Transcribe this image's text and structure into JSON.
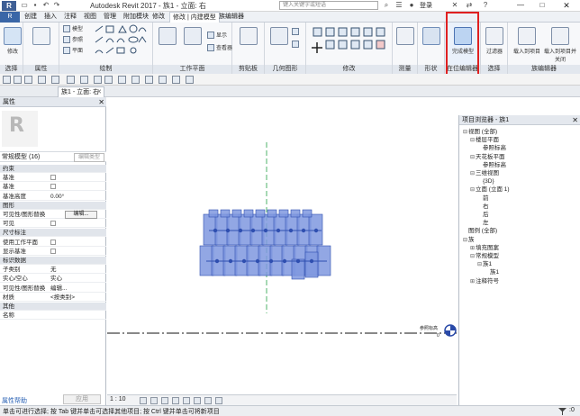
{
  "titlebar": {
    "app_logo": "R",
    "title": "Autodesk Revit 2017 -   族1 - 立面: 右",
    "search_placeholder": "键入关键字或短语",
    "user": "登录",
    "min": "—",
    "max": "□",
    "close": "✕"
  },
  "ribbon_tabs": {
    "file": "R",
    "tabs": [
      "创建",
      "插入",
      "注释",
      "视图",
      "管理",
      "附加模块",
      "修改",
      "修改 | 内建模型",
      "族编辑器"
    ]
  },
  "ribbon": {
    "modify_label": "修改",
    "panels": [
      "选择",
      "属性",
      "绘制",
      "工作平面",
      "剪贴板",
      "几何图形",
      "修改",
      "测量",
      "形状",
      "在位编辑器",
      "选择",
      "族编辑器"
    ],
    "draw_rows": [
      "模型",
      "参照",
      "平面"
    ],
    "tool_rows_a": [
      "显示",
      "查看器"
    ],
    "finish_model_label": "完成模型",
    "filter_label": "过滤器",
    "load_into_project_label": "载入到项目",
    "load_into_project_close_label": "载入到项目并关闭"
  },
  "view_tab": {
    "label": "族1 - 立面: 右",
    "close": "✕"
  },
  "properties": {
    "title": "属性",
    "close": "✕",
    "thumb_letter": "R",
    "type_selector": "常规模型 (16)",
    "edit_type_label": "编辑类型",
    "rows": [
      {
        "kind": "cat",
        "k": "约束"
      },
      {
        "kind": "cb",
        "k": "基准"
      },
      {
        "kind": "cb",
        "k": "基准"
      },
      {
        "kind": "val",
        "k": "基准高度",
        "v": "0.00°"
      },
      {
        "kind": "cat",
        "k": "图形"
      },
      {
        "kind": "box",
        "k": "可见性/图形替换",
        "v": "编辑..."
      },
      {
        "kind": "cb",
        "k": "可见"
      },
      {
        "kind": "cat",
        "k": "尺寸标注"
      },
      {
        "kind": "cb",
        "k": "使用工作平面"
      },
      {
        "kind": "cb",
        "k": "显示基准"
      },
      {
        "kind": "cat",
        "k": "标识数据"
      },
      {
        "kind": "val",
        "k": "子类别",
        "v": "无"
      },
      {
        "kind": "val",
        "k": "实心/空心",
        "v": "实心"
      },
      {
        "kind": "val",
        "k": "可见性/图形替换",
        "v": "编辑..."
      },
      {
        "kind": "val",
        "k": "材质",
        "v": "<按类别>"
      },
      {
        "kind": "cat",
        "k": "其他"
      },
      {
        "kind": "val",
        "k": "名称",
        "v": ""
      }
    ],
    "help_link": "属性帮助",
    "apply_label": "应用"
  },
  "project_browser": {
    "title": "项目浏览器 - 族1",
    "close": "✕",
    "nodes": [
      {
        "depth": 0,
        "exp": "⊟",
        "label": "视图 (全部)"
      },
      {
        "depth": 1,
        "exp": "⊟",
        "label": "楼层平面"
      },
      {
        "depth": 2,
        "exp": "",
        "label": "参照标高"
      },
      {
        "depth": 1,
        "exp": "⊟",
        "label": "天花板平面"
      },
      {
        "depth": 2,
        "exp": "",
        "label": "参照标高"
      },
      {
        "depth": 1,
        "exp": "⊟",
        "label": "三维视图"
      },
      {
        "depth": 2,
        "exp": "",
        "label": "{3D}"
      },
      {
        "depth": 1,
        "exp": "⊟",
        "label": "立面 (立面 1)"
      },
      {
        "depth": 2,
        "exp": "",
        "label": "前"
      },
      {
        "depth": 2,
        "exp": "",
        "label": "右"
      },
      {
        "depth": 2,
        "exp": "",
        "label": "后"
      },
      {
        "depth": 2,
        "exp": "",
        "label": "左"
      },
      {
        "depth": 0,
        "exp": "",
        "label": "图例 (全部)"
      },
      {
        "depth": 0,
        "exp": "⊟",
        "label": "族"
      },
      {
        "depth": 1,
        "exp": "⊞",
        "label": "填充图案"
      },
      {
        "depth": 1,
        "exp": "⊟",
        "label": "常规模型"
      },
      {
        "depth": 2,
        "exp": "⊟",
        "label": "族1"
      },
      {
        "depth": 3,
        "exp": "",
        "label": "族1"
      },
      {
        "depth": 1,
        "exp": "⊞",
        "label": "注释符号"
      }
    ]
  },
  "canvas": {
    "level_tag": "参照标高",
    "level_value": "0"
  },
  "viewbar": {
    "scale": "1 : 10"
  },
  "statusbar": {
    "text": "单击可进行选择; 按 Tab 键并单击可选择其他项目; 按 Ctrl 键并单击可将新项目",
    "filter_count": ":0"
  },
  "colors": {
    "accent": "#3a66a7",
    "highlight_box": "#e02020",
    "element_fill": "#7f98df",
    "element_edge": "#2f4fb0",
    "dashed_ref": "#4fb36a"
  }
}
